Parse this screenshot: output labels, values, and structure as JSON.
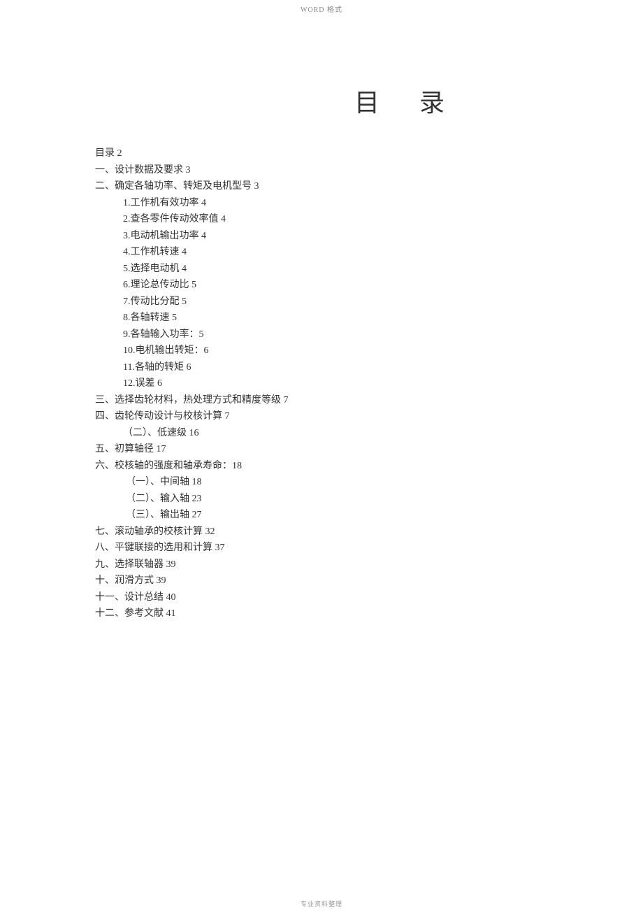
{
  "header": "WORD 格式",
  "title": "目 录",
  "footer": "专业资料整理",
  "toc": [
    {
      "text": "目录 2",
      "indent": 0
    },
    {
      "text": "一、设计数据及要求 3",
      "indent": 0
    },
    {
      "text": "二、确定各轴功率、转矩及电机型号 3",
      "indent": 0
    },
    {
      "text": "1.工作机有效功率 4",
      "indent": 1
    },
    {
      "text": "2.查各零件传动效率值 4",
      "indent": 1
    },
    {
      "text": "3.电动机输出功率 4",
      "indent": 1
    },
    {
      "text": "4.工作机转速 4",
      "indent": 1
    },
    {
      "text": "5.选择电动机 4",
      "indent": 1
    },
    {
      "text": "6.理论总传动比 5",
      "indent": 1
    },
    {
      "text": "7.传动比分配 5",
      "indent": 1
    },
    {
      "text": "8.各轴转速 5",
      "indent": 1
    },
    {
      "text": "9.各轴输入功率：5",
      "indent": 1
    },
    {
      "text": "10.电机输出转矩：6",
      "indent": 1
    },
    {
      "text": "11.各轴的转矩 6",
      "indent": 1
    },
    {
      "text": "12.误差 6",
      "indent": 1
    },
    {
      "text": "三、选择齿轮材料，热处理方式和精度等级 7",
      "indent": 0
    },
    {
      "text": "四、齿轮传动设计与校核计算 7",
      "indent": 0
    },
    {
      "text": "（二）、低速级 16",
      "indent": 1
    },
    {
      "text": "五、初算轴径 17",
      "indent": 0
    },
    {
      "text": "六、校核轴的强度和轴承寿命：18",
      "indent": 0
    },
    {
      "text": "（一）、中间轴 18",
      "indent": 2
    },
    {
      "text": "（二）、输入轴 23",
      "indent": 2
    },
    {
      "text": "（三）、输出轴 27",
      "indent": 2
    },
    {
      "text": "七、滚动轴承的校核计算 32",
      "indent": 0
    },
    {
      "text": "八、平键联接的选用和计算 37",
      "indent": 0
    },
    {
      "text": "九、选择联轴器 39",
      "indent": 0
    },
    {
      "text": "十、润滑方式 39",
      "indent": 0
    },
    {
      "text": "十一、设计总结 40",
      "indent": 0
    },
    {
      "text": "十二、参考文献 41",
      "indent": 0
    }
  ]
}
